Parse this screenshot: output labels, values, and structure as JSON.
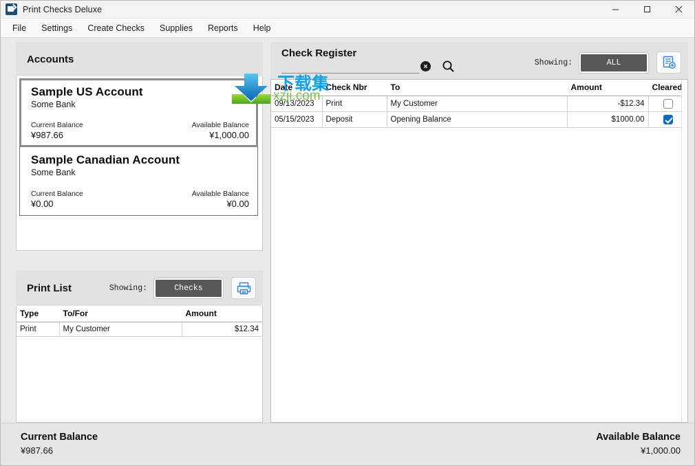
{
  "window": {
    "title": "Print Checks Deluxe",
    "app_icon": "app-icon",
    "minimize_label": "—",
    "maximize_label": "□",
    "close_label": "✕"
  },
  "menu": {
    "items": [
      {
        "label": "File"
      },
      {
        "label": "Settings"
      },
      {
        "label": "Create Checks"
      },
      {
        "label": "Supplies"
      },
      {
        "label": "Reports"
      },
      {
        "label": "Help"
      }
    ]
  },
  "watermark": {
    "cn_text": "下载集",
    "url_text": "xzji.com",
    "logo_icon": "download-arrow-logo-icon"
  },
  "accounts": {
    "title": "Accounts",
    "cards": [
      {
        "name": "Sample  US Account",
        "bank": "Some Bank",
        "current_label": "Current Balance",
        "current_value": "¥987.66",
        "available_label": "Available Balance",
        "available_value": "¥1,000.00",
        "selected": true
      },
      {
        "name": "Sample Canadian Account",
        "bank": "Some Bank",
        "current_label": "Current Balance",
        "current_value": "¥0.00",
        "available_label": "Available Balance",
        "available_value": "¥0.00",
        "selected": false
      }
    ]
  },
  "print_list": {
    "title": "Print List",
    "showing_label": "Showing:",
    "filter_value": "Checks",
    "print_icon": "printer-icon",
    "columns": [
      "Type",
      "To/For",
      "Amount"
    ],
    "rows": [
      {
        "type": "Print",
        "to_for": "My Customer",
        "amount": "$12.34"
      }
    ]
  },
  "check_register": {
    "title": "Check Register",
    "search_value": "",
    "search_placeholder": "",
    "clear_icon": "clear-circle-icon",
    "search_icon": "search-icon",
    "showing_label": "Showing:",
    "filter_value": "ALL",
    "add_entry_icon": "add-register-entry-icon",
    "columns": [
      "Date",
      "Check Nbr",
      "To",
      "Amount",
      "Cleared"
    ],
    "rows": [
      {
        "date": "09/13/2023",
        "check_nbr": "Print",
        "to": "My Customer",
        "amount": "-$12.34",
        "amount_negative": true,
        "cleared": false
      },
      {
        "date": "05/15/2023",
        "check_nbr": "Deposit",
        "to": "Opening Balance",
        "amount": "$1000.00",
        "amount_negative": false,
        "cleared": true
      }
    ]
  },
  "footer": {
    "current_label": "Current Balance",
    "current_value": "¥987.66",
    "available_label": "Available Balance",
    "available_value": "¥1,000.00"
  },
  "colors": {
    "accent_blue": "#1a6fd4",
    "segment_bg": "#575757",
    "negative": "#9c1515",
    "checkbox_on": "#0f6cbd"
  }
}
